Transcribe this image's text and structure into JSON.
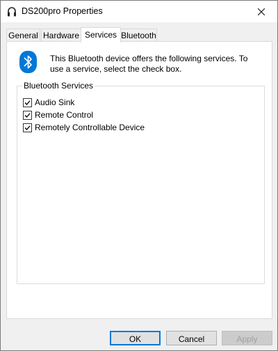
{
  "window": {
    "title": "DS200pro Properties"
  },
  "tabs": [
    {
      "label": "General",
      "active": false
    },
    {
      "label": "Hardware",
      "active": false
    },
    {
      "label": "Services",
      "active": true
    },
    {
      "label": "Bluetooth",
      "active": false
    }
  ],
  "services_panel": {
    "info_text": "This Bluetooth device offers the following services. To use a service, select the check box.",
    "group_title": "Bluetooth Services",
    "services": [
      {
        "label": "Audio Sink",
        "checked": true
      },
      {
        "label": "Remote Control",
        "checked": true
      },
      {
        "label": "Remotely Controllable Device",
        "checked": true
      }
    ]
  },
  "buttons": {
    "ok": "OK",
    "cancel": "Cancel",
    "apply": "Apply"
  },
  "colors": {
    "bluetooth_blue": "#0078d7",
    "panel_bg": "#ffffff",
    "dialog_bg": "#f0f0f0"
  }
}
